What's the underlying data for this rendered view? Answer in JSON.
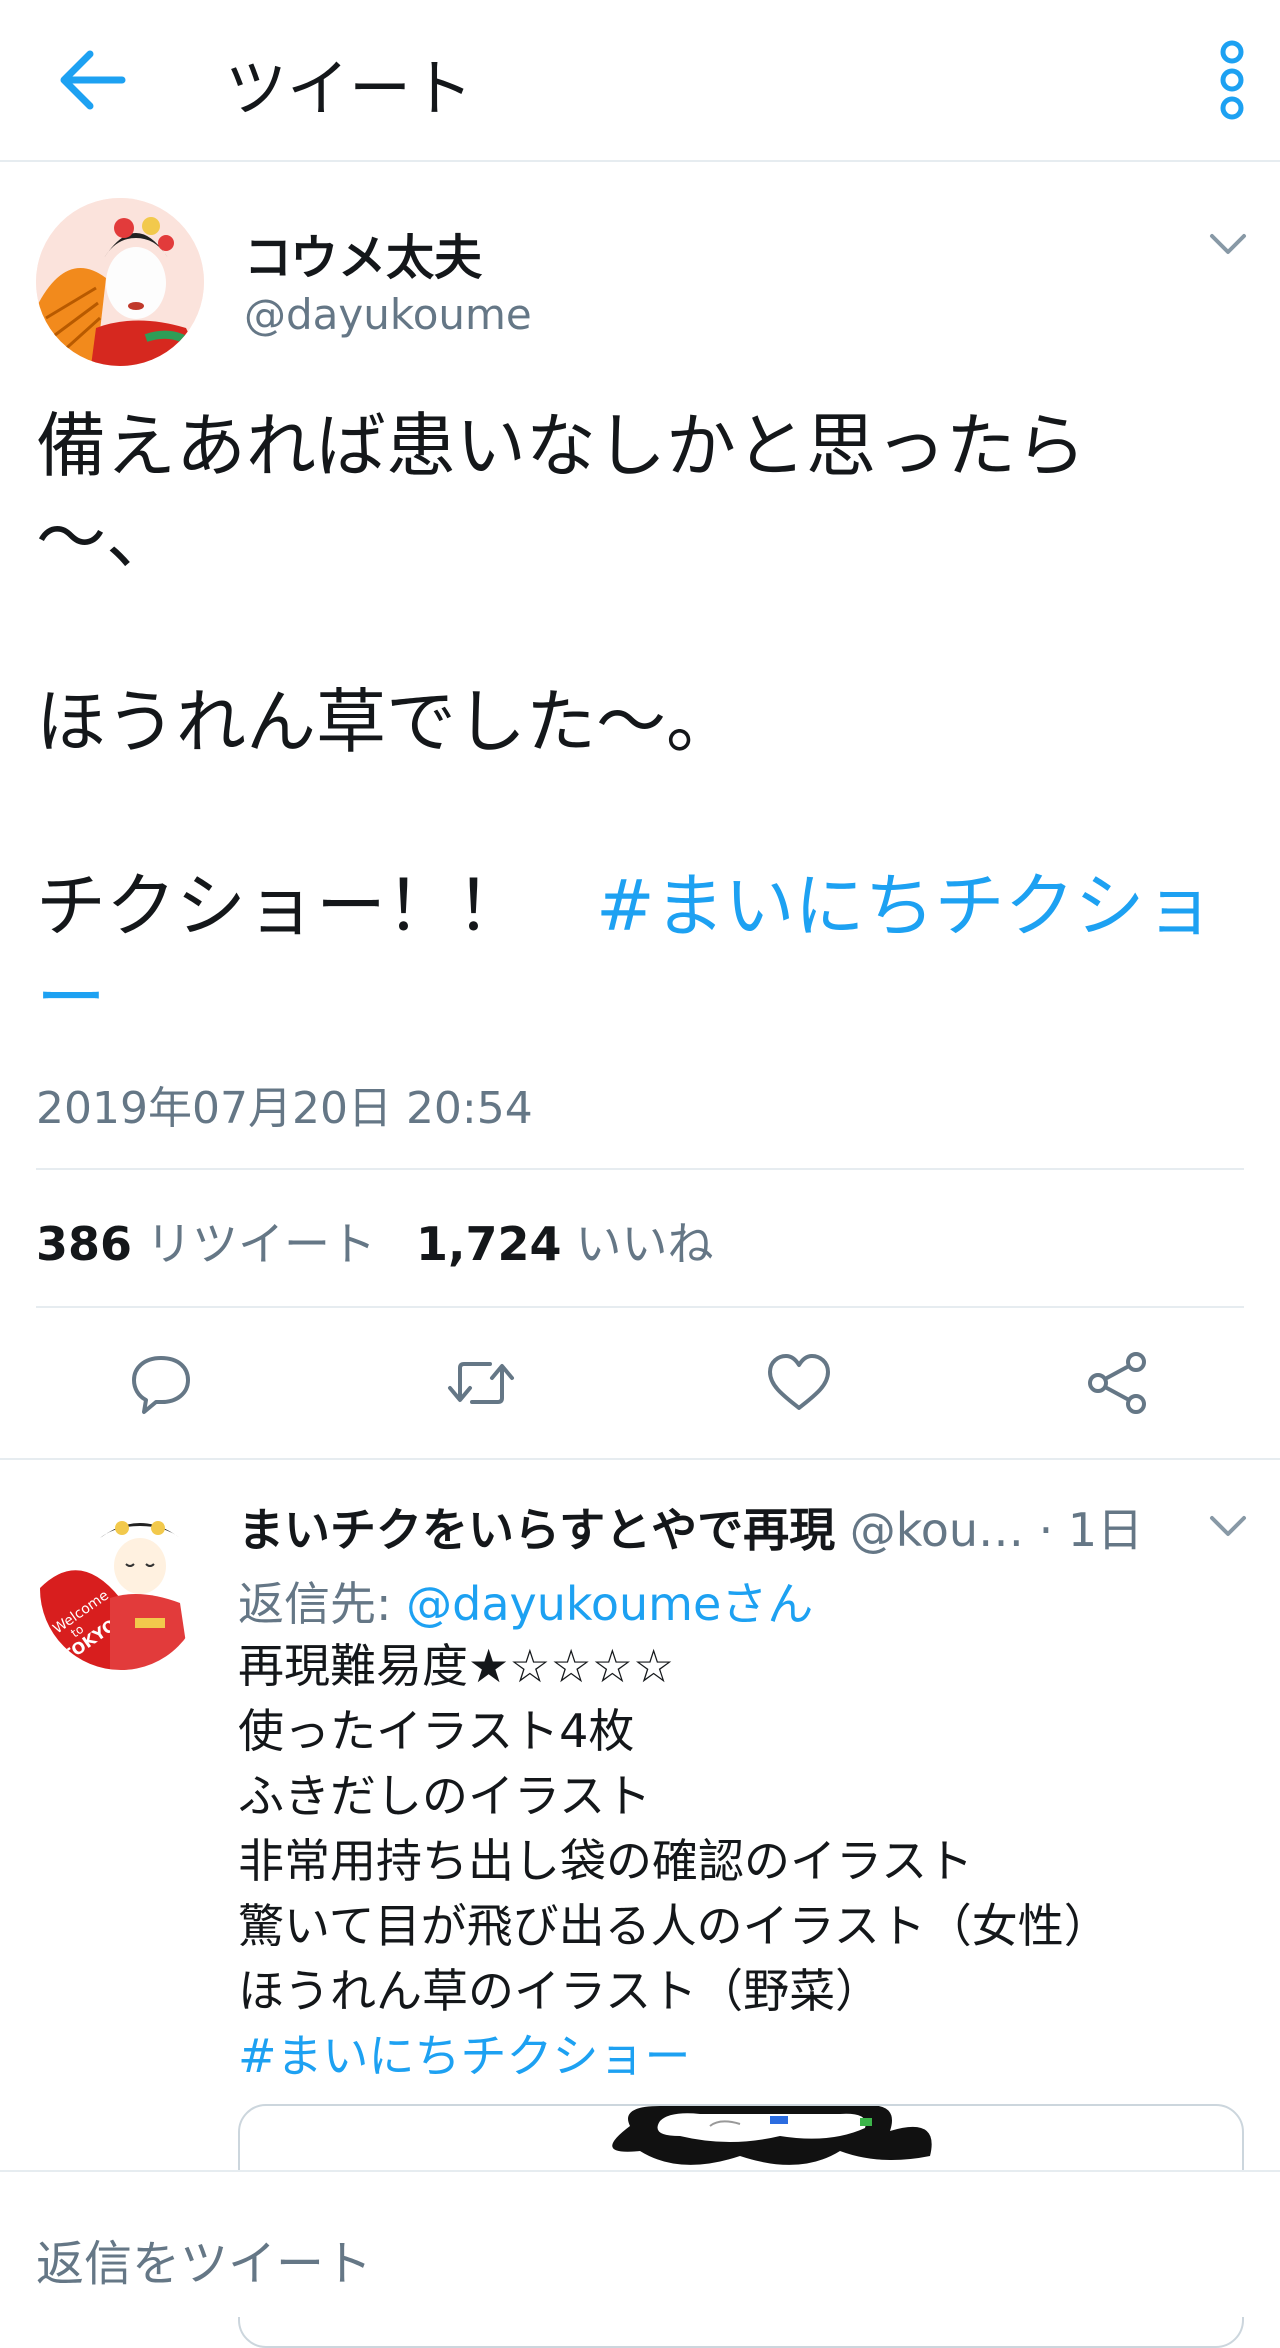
{
  "topbar": {
    "title": "ツイート",
    "back_icon": "arrow-left-icon",
    "more_icon": "vertical-dots-icon"
  },
  "tweet": {
    "author_name": "コウメ太夫",
    "author_handle": "@dayukoume",
    "text_lines": [
      "備えあれば患いなしかと思ったら",
      "〜、",
      "",
      "ほうれん草でした〜。",
      "",
      "チクショー！！　"
    ],
    "hashtag": "#まいにちチクショー",
    "timestamp": "2019年07月20日 20:54",
    "retweet_count": "386",
    "retweet_label": "リツイート",
    "like_count": "1,724",
    "like_label": "いいね"
  },
  "actions": [
    "reply-icon",
    "retweet-icon",
    "heart-icon",
    "share-icon"
  ],
  "reply": {
    "author_name": "まいチクをいらすとやで再現",
    "author_handle": "@kou…",
    "time": "· 1日",
    "reply_to_prefix": "返信先: ",
    "reply_to_user": "@dayukoumeさん",
    "lines": [
      "再現難易度★☆☆☆☆",
      "使ったイラスト4枚",
      "ふきだしのイラスト",
      "非常用持ち出し袋の確認のイラスト",
      "驚いて目が飛び出る人のイラスト（女性）",
      "ほうれん草のイラスト（野菜）"
    ],
    "hashtag": "#まいにちチクショー",
    "avatar_text": [
      "Welcome",
      "to",
      "TOKYO"
    ]
  },
  "composer": {
    "placeholder": "返信をツイート"
  },
  "colors": {
    "accent": "#1da1f2",
    "text": "#14171a",
    "secondary": "#657786",
    "divider": "#e6ecf0"
  }
}
